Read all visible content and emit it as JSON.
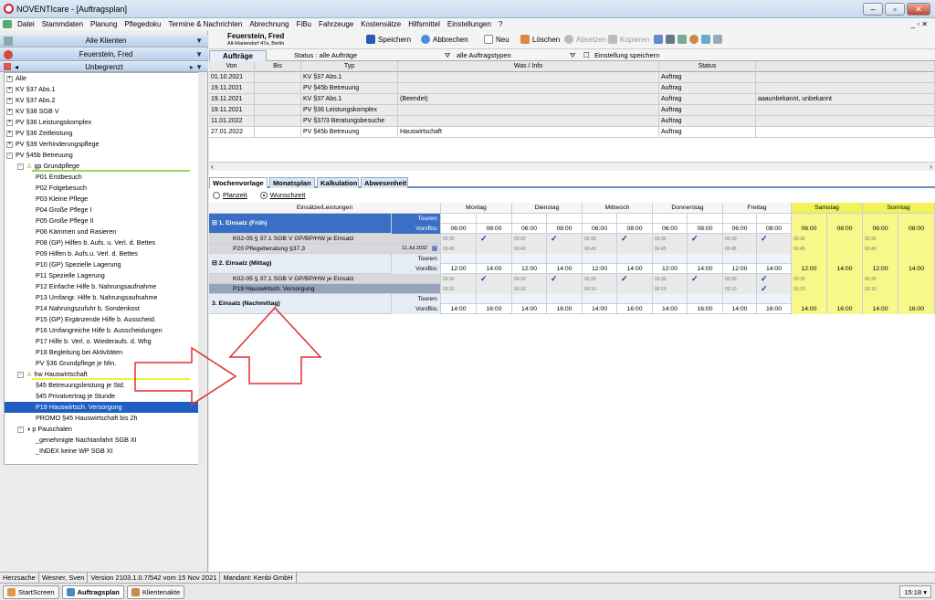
{
  "window": {
    "title": "NOVENTIcare - [Auftragsplan]"
  },
  "menu": [
    "Datei",
    "Stammdaten",
    "Planung",
    "Pflegedoku",
    "Termine & Nachrichten",
    "Abrechnung",
    "FiBu",
    "Fahrzeuge",
    "Kostensätze",
    "Hilfsmittel",
    "Einstellungen",
    "?"
  ],
  "left": {
    "clients": "Alle Klienten",
    "client": "Feuerstein, Fred",
    "period": "Unbegrenzt",
    "tree": [
      {
        "t": "Alle",
        "lvl": 0,
        "pm": "+"
      },
      {
        "t": "KV §37 Abs.1",
        "lvl": 0,
        "pm": "+"
      },
      {
        "t": "KV §37 Abs.2",
        "lvl": 0,
        "pm": "+"
      },
      {
        "t": "KV §38 SGB V",
        "lvl": 0,
        "pm": "+"
      },
      {
        "t": "PV §36 Leistungskomplex",
        "lvl": 0,
        "pm": "+"
      },
      {
        "t": "PV §36 Zeitleistung",
        "lvl": 0,
        "pm": "+"
      },
      {
        "t": "PV §39 Verhinderungspflege",
        "lvl": 0,
        "pm": "+"
      },
      {
        "t": "PV §45b Betreuung",
        "lvl": 0,
        "pm": "-"
      },
      {
        "t": "gp   Grundpflege",
        "lvl": 1,
        "pm": "-",
        "grp": "#9bd85a"
      },
      {
        "t": "P01 Erstbesuch",
        "lvl": 2
      },
      {
        "t": "P02 Folgebesuch",
        "lvl": 2
      },
      {
        "t": "P03 Kleine Pflege",
        "lvl": 2
      },
      {
        "t": "P04 Große Pflege I",
        "lvl": 2
      },
      {
        "t": "P05 Große Pflege II",
        "lvl": 2
      },
      {
        "t": "P06 Kämmen und Rasieren",
        "lvl": 2
      },
      {
        "t": "P08 (GP) Hilfen b. Aufs. u. Verl. d. Bettes",
        "lvl": 2
      },
      {
        "t": "P09 Hilfen b. Aufs.u. Verl. d. Bettes",
        "lvl": 2
      },
      {
        "t": "P10 (GP) Spezielle Lagerung",
        "lvl": 2
      },
      {
        "t": "P11 Spezielle Lagerung",
        "lvl": 2
      },
      {
        "t": "P12 Einfache Hilfe b. Nahrungsaufnahme",
        "lvl": 2
      },
      {
        "t": "P13 Umfangr. Hilfe b. Nahrungsaufnahme",
        "lvl": 2
      },
      {
        "t": "P14 Nahrungszufuhr b. Sondenkost",
        "lvl": 2
      },
      {
        "t": "P15 (GP) Ergänzende Hilfe b. Ausscheid.",
        "lvl": 2
      },
      {
        "t": "P16 Umfangreiche Hilfe b. Ausscheidungen",
        "lvl": 2
      },
      {
        "t": "P17 Hilfe b. Verl. o. Wiederaufs. d. Whg",
        "lvl": 2
      },
      {
        "t": "P18 Begleitung bei Aktivitäten",
        "lvl": 2
      },
      {
        "t": "PV §36 Grundpflege je Min.",
        "lvl": 2
      },
      {
        "t": "hw   Hauswirtschaft",
        "lvl": 1,
        "pm": "-",
        "grp": "#f0f040"
      },
      {
        "t": "§45 Betreuungsleistung je Std.",
        "lvl": 2
      },
      {
        "t": "§45 Privatvertrag je Stunde",
        "lvl": 2
      },
      {
        "t": "P19 Hauswirtsch. Versorgung",
        "lvl": 2,
        "sel": true
      },
      {
        "t": "PROMO §45 Hauswirtschaft bis 2h",
        "lvl": 2
      },
      {
        "t": "p    Pauschalen",
        "lvl": 1,
        "pm": "-"
      },
      {
        "t": "_genehmigte Nachtanfahrt SGB XI",
        "lvl": 2
      },
      {
        "t": "_INDEX keine WP SGB XI",
        "lvl": 2
      }
    ]
  },
  "patient": {
    "name": "Feuerstein, Fred",
    "address": "Alt-Mariendorf 47a, Berlin"
  },
  "toolbar": {
    "save": "Speichern",
    "cancel": "Abbrechen",
    "new": "Neu",
    "delete": "Löschen",
    "close_order": "Absetzen",
    "copy": "Kopieren"
  },
  "filters": {
    "tab": "Aufträge",
    "status": "Status :  alle Aufträge",
    "types": "alle Auftragstypen",
    "save_setting": "Einstellung speichern"
  },
  "orders": {
    "headers": [
      "Von",
      "Bis",
      "Typ",
      "Was / Info",
      "Status"
    ],
    "rows": [
      [
        "01.10.2021",
        "",
        "KV §37 Abs.1",
        "",
        "Auftrag",
        ""
      ],
      [
        "19.11.2021",
        "",
        "PV §45b Betreuung",
        "",
        "Auftrag",
        ""
      ],
      [
        "19.11.2021",
        "",
        "KV §37 Abs.1",
        "(Beendet)",
        "Auftrag",
        "aaaunbekannt, unbekannt"
      ],
      [
        "19.11.2021",
        "",
        "PV §36 Leistungskomplex",
        "",
        "Auftrag",
        ""
      ],
      [
        "11.01.2022",
        "",
        "PV §37/3 Beratungsbesuche",
        "",
        "Auftrag",
        ""
      ],
      [
        "27.01.2022",
        "",
        "PV §45b Betreuung",
        "Hauswirtschaft",
        "Auftrag",
        ""
      ]
    ]
  },
  "subtabs": [
    "Wochenvorlage",
    "Monatsplan",
    "Kalkulation",
    "Abwesenheit"
  ],
  "radios": {
    "plan": "Planzeit",
    "wish": "Wunschzeit"
  },
  "week": {
    "col_header": "Einsätze/Leistungen",
    "days": [
      "Montag",
      "Dienstag",
      "Mittwoch",
      "Donnerstag",
      "Freitag",
      "Samstag",
      "Sonntag"
    ],
    "touren": "Touren:",
    "vonbis": "Von/Bis:",
    "blocks": [
      {
        "title": "1. Einsatz (Früh)",
        "from": "06:00",
        "to": "08:00",
        "services": [
          {
            "name": "K02-05 § 37.1 SGB V GP/BP/HW je Einsatz",
            "dur": "00:30",
            "checks": [
              true,
              true,
              true,
              true,
              true,
              false,
              false
            ]
          },
          {
            "name": "P20 Pflegeberatung §37.3",
            "date": "11.Jul.2032",
            "dur": "00:45",
            "checks": [
              false,
              false,
              false,
              false,
              false,
              false,
              false
            ]
          }
        ]
      },
      {
        "title": "2. Einsatz (Mittag)",
        "from": "12:00",
        "to": "14:00",
        "services": [
          {
            "name": "K02-05 § 37.1 SGB V GP/BP/HW je Einsatz",
            "dur": "00:30",
            "checks": [
              true,
              true,
              true,
              true,
              true,
              false,
              false
            ]
          },
          {
            "name": "P19 Hauswirtsch. Versorgung",
            "dur": "00:10",
            "checks": [
              false,
              false,
              false,
              false,
              true,
              false,
              false
            ],
            "sel": true
          }
        ]
      },
      {
        "title": "3. Einsatz (Nachmittag)",
        "from": "14:00",
        "to": "16:00",
        "services": []
      }
    ]
  },
  "status": [
    "Herzsache",
    "Wesner, Sven",
    "Version 2103.1.0.7/542  vom 15 Nov 2021",
    "Mandant: Kenbi GmbH"
  ],
  "taskbar": [
    "StartScreen",
    "Auftragsplan",
    "Klientenakte"
  ],
  "clock": "15:18"
}
